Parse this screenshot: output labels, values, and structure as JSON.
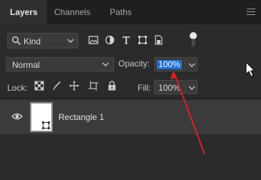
{
  "tabs": [
    {
      "label": "Layers",
      "active": true
    },
    {
      "label": "Channels",
      "active": false
    },
    {
      "label": "Paths",
      "active": false
    }
  ],
  "filter": {
    "kind_label": "Kind",
    "icons": [
      "image-filter-icon",
      "adjustment-filter-icon",
      "type-filter-icon",
      "shape-filter-icon",
      "smart-object-filter-icon",
      "filter-toggle-icon"
    ]
  },
  "blend_mode": {
    "value": "Normal"
  },
  "opacity": {
    "label": "Opacity:",
    "value": "100%"
  },
  "lock": {
    "label": "Lock:",
    "icons": [
      "lock-transparent-pixels-icon",
      "lock-image-pixels-icon",
      "lock-position-icon",
      "lock-artboard-icon",
      "lock-all-icon"
    ]
  },
  "fill": {
    "label": "Fill:",
    "value": "100%"
  },
  "layers": [
    {
      "name": "Rectangle 1",
      "visible": true
    }
  ],
  "colors": {
    "panel_bg": "#2b2b2b",
    "selection": "#1e6fd1",
    "annotation": "#e02020"
  }
}
